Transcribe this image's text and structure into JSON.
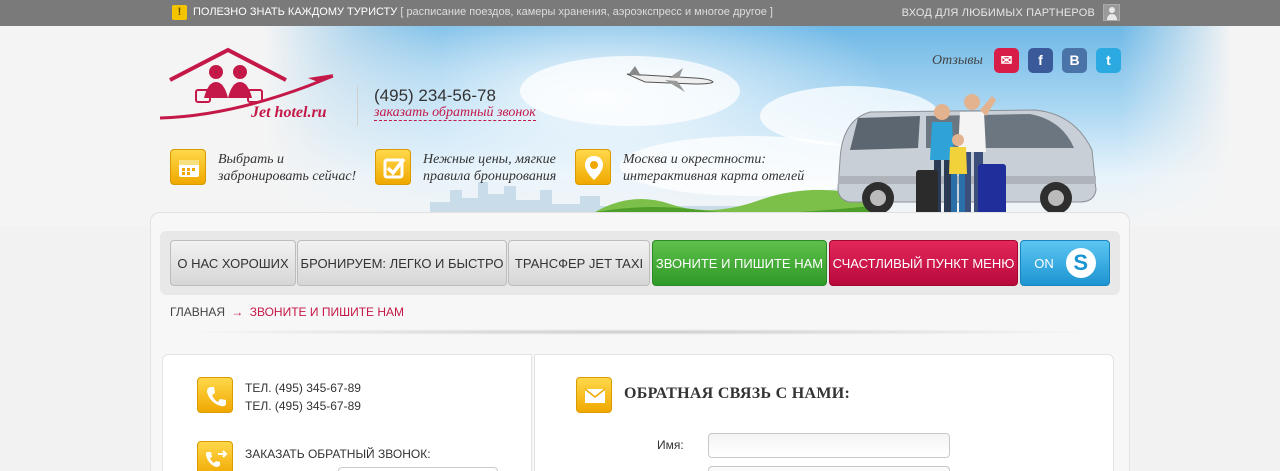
{
  "topbar": {
    "tip_title": "ПОЛЕЗНО ЗНАТЬ КАЖДОМУ ТУРИСТУ",
    "tip_details": "[ расписание поездов, камеры хранения, аэроэкспресс и многое другое ]",
    "partners_login": "ВХОД ДЛЯ ЛЮБИМЫХ ПАРТНЕРОВ"
  },
  "header": {
    "logo_text": "Jet hotel.ru",
    "phone": "(495) 234-56-78",
    "callback_link": "заказать обратный звонок",
    "reviews_label": "Отзывы",
    "social": [
      "reviews-icon",
      "facebook-icon",
      "vkontakte-icon",
      "twitter-icon"
    ],
    "features": [
      {
        "icon": "calendar-icon",
        "line1": "Выбрать и",
        "line2": "забронировать сейчас!"
      },
      {
        "icon": "checkbox-icon",
        "line1": "Нежные цены, мягкие",
        "line2": "правила бронирования"
      },
      {
        "icon": "map-pin-icon",
        "line1": "Москва и окрестности:",
        "line2": "интерактивная карта отелей"
      }
    ]
  },
  "nav": {
    "items": [
      {
        "label": "О НАС ХОРОШИХ",
        "style": "grey"
      },
      {
        "label": "БРОНИРУЕМ: ЛЕГКО И БЫСТРО",
        "style": "grey"
      },
      {
        "label": "ТРАНСФЕР JET TAXI",
        "style": "grey"
      },
      {
        "label": "ЗВОНИТЕ И ПИШИТЕ НАМ",
        "style": "green"
      },
      {
        "label": "СЧАСТЛИВЫЙ ПУНКТ МЕНЮ",
        "style": "red"
      },
      {
        "label": "ON",
        "style": "blue",
        "icon": "skype-icon"
      }
    ]
  },
  "breadcrumb": {
    "home": "ГЛАВНАЯ",
    "separator": "→",
    "current": "ЗВОНИТЕ И ПИШИТЕ НАМ"
  },
  "contacts": {
    "tel1": "ТЕЛ. (495) 345-67-89",
    "tel2": "ТЕЛ. (495) 345-67-89",
    "order_call": "ЗАКАЗАТЬ ОБРАТНЫЙ ЗВОНОК:"
  },
  "feedback": {
    "title": "ОБРАТНАЯ СВЯЗЬ С НАМИ:",
    "name_label": "Имя:",
    "name_value": ""
  },
  "colors": {
    "accent": "#c41848",
    "green": "#3aa332",
    "blue": "#1d94d2",
    "yellow": "#f5b800",
    "topbar": "#7a7a7a"
  }
}
